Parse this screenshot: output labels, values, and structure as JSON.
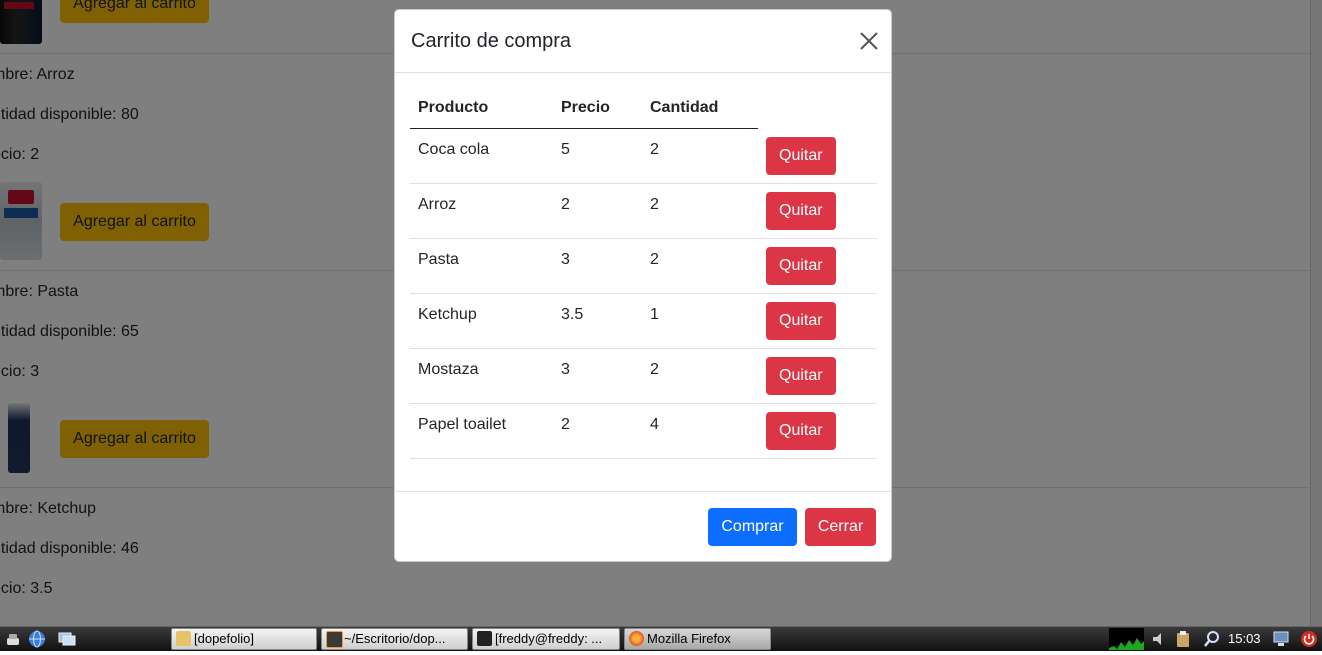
{
  "page": {
    "add_to_cart_label": "Agregar al carrito",
    "products": [
      {
        "name_line": "mbre: Arroz",
        "qty_line": "ntidad disponible: 80",
        "price_line": "ecio: 2"
      },
      {
        "name_line": "mbre: Pasta",
        "qty_line": "ntidad disponible: 65",
        "price_line": "ecio: 3"
      },
      {
        "name_line": "mbre: Ketchup",
        "qty_line": "ntidad disponible: 46",
        "price_line": "ecio: 3.5"
      }
    ]
  },
  "modal": {
    "title": "Carrito de compra",
    "columns": [
      "Producto",
      "Precio",
      "Cantidad"
    ],
    "rows": [
      {
        "producto": "Coca cola",
        "precio": "5",
        "cantidad": "2"
      },
      {
        "producto": "Arroz",
        "precio": "2",
        "cantidad": "2"
      },
      {
        "producto": "Pasta",
        "precio": "3",
        "cantidad": "2"
      },
      {
        "producto": "Ketchup",
        "precio": "3.5",
        "cantidad": "1"
      },
      {
        "producto": "Mostaza",
        "precio": "3",
        "cantidad": "2"
      },
      {
        "producto": "Papel toailet",
        "precio": "2",
        "cantidad": "4"
      }
    ],
    "remove_label": "Quitar",
    "buy_label": "Comprar",
    "close_label": "Cerrar"
  },
  "taskbar": {
    "tasks": [
      {
        "label": "[dopefolio]",
        "icon": "folder-icon"
      },
      {
        "label": "~/Escritorio/dop...",
        "icon": "sublime-text-icon"
      },
      {
        "label": "[freddy@freddy: ...",
        "icon": "terminal-icon"
      },
      {
        "label": "Mozilla Firefox",
        "icon": "firefox-icon"
      }
    ],
    "clock": "15:03"
  },
  "colors": {
    "add_button": "#ffc107",
    "danger": "#dc3545",
    "primary": "#0d6efd"
  }
}
